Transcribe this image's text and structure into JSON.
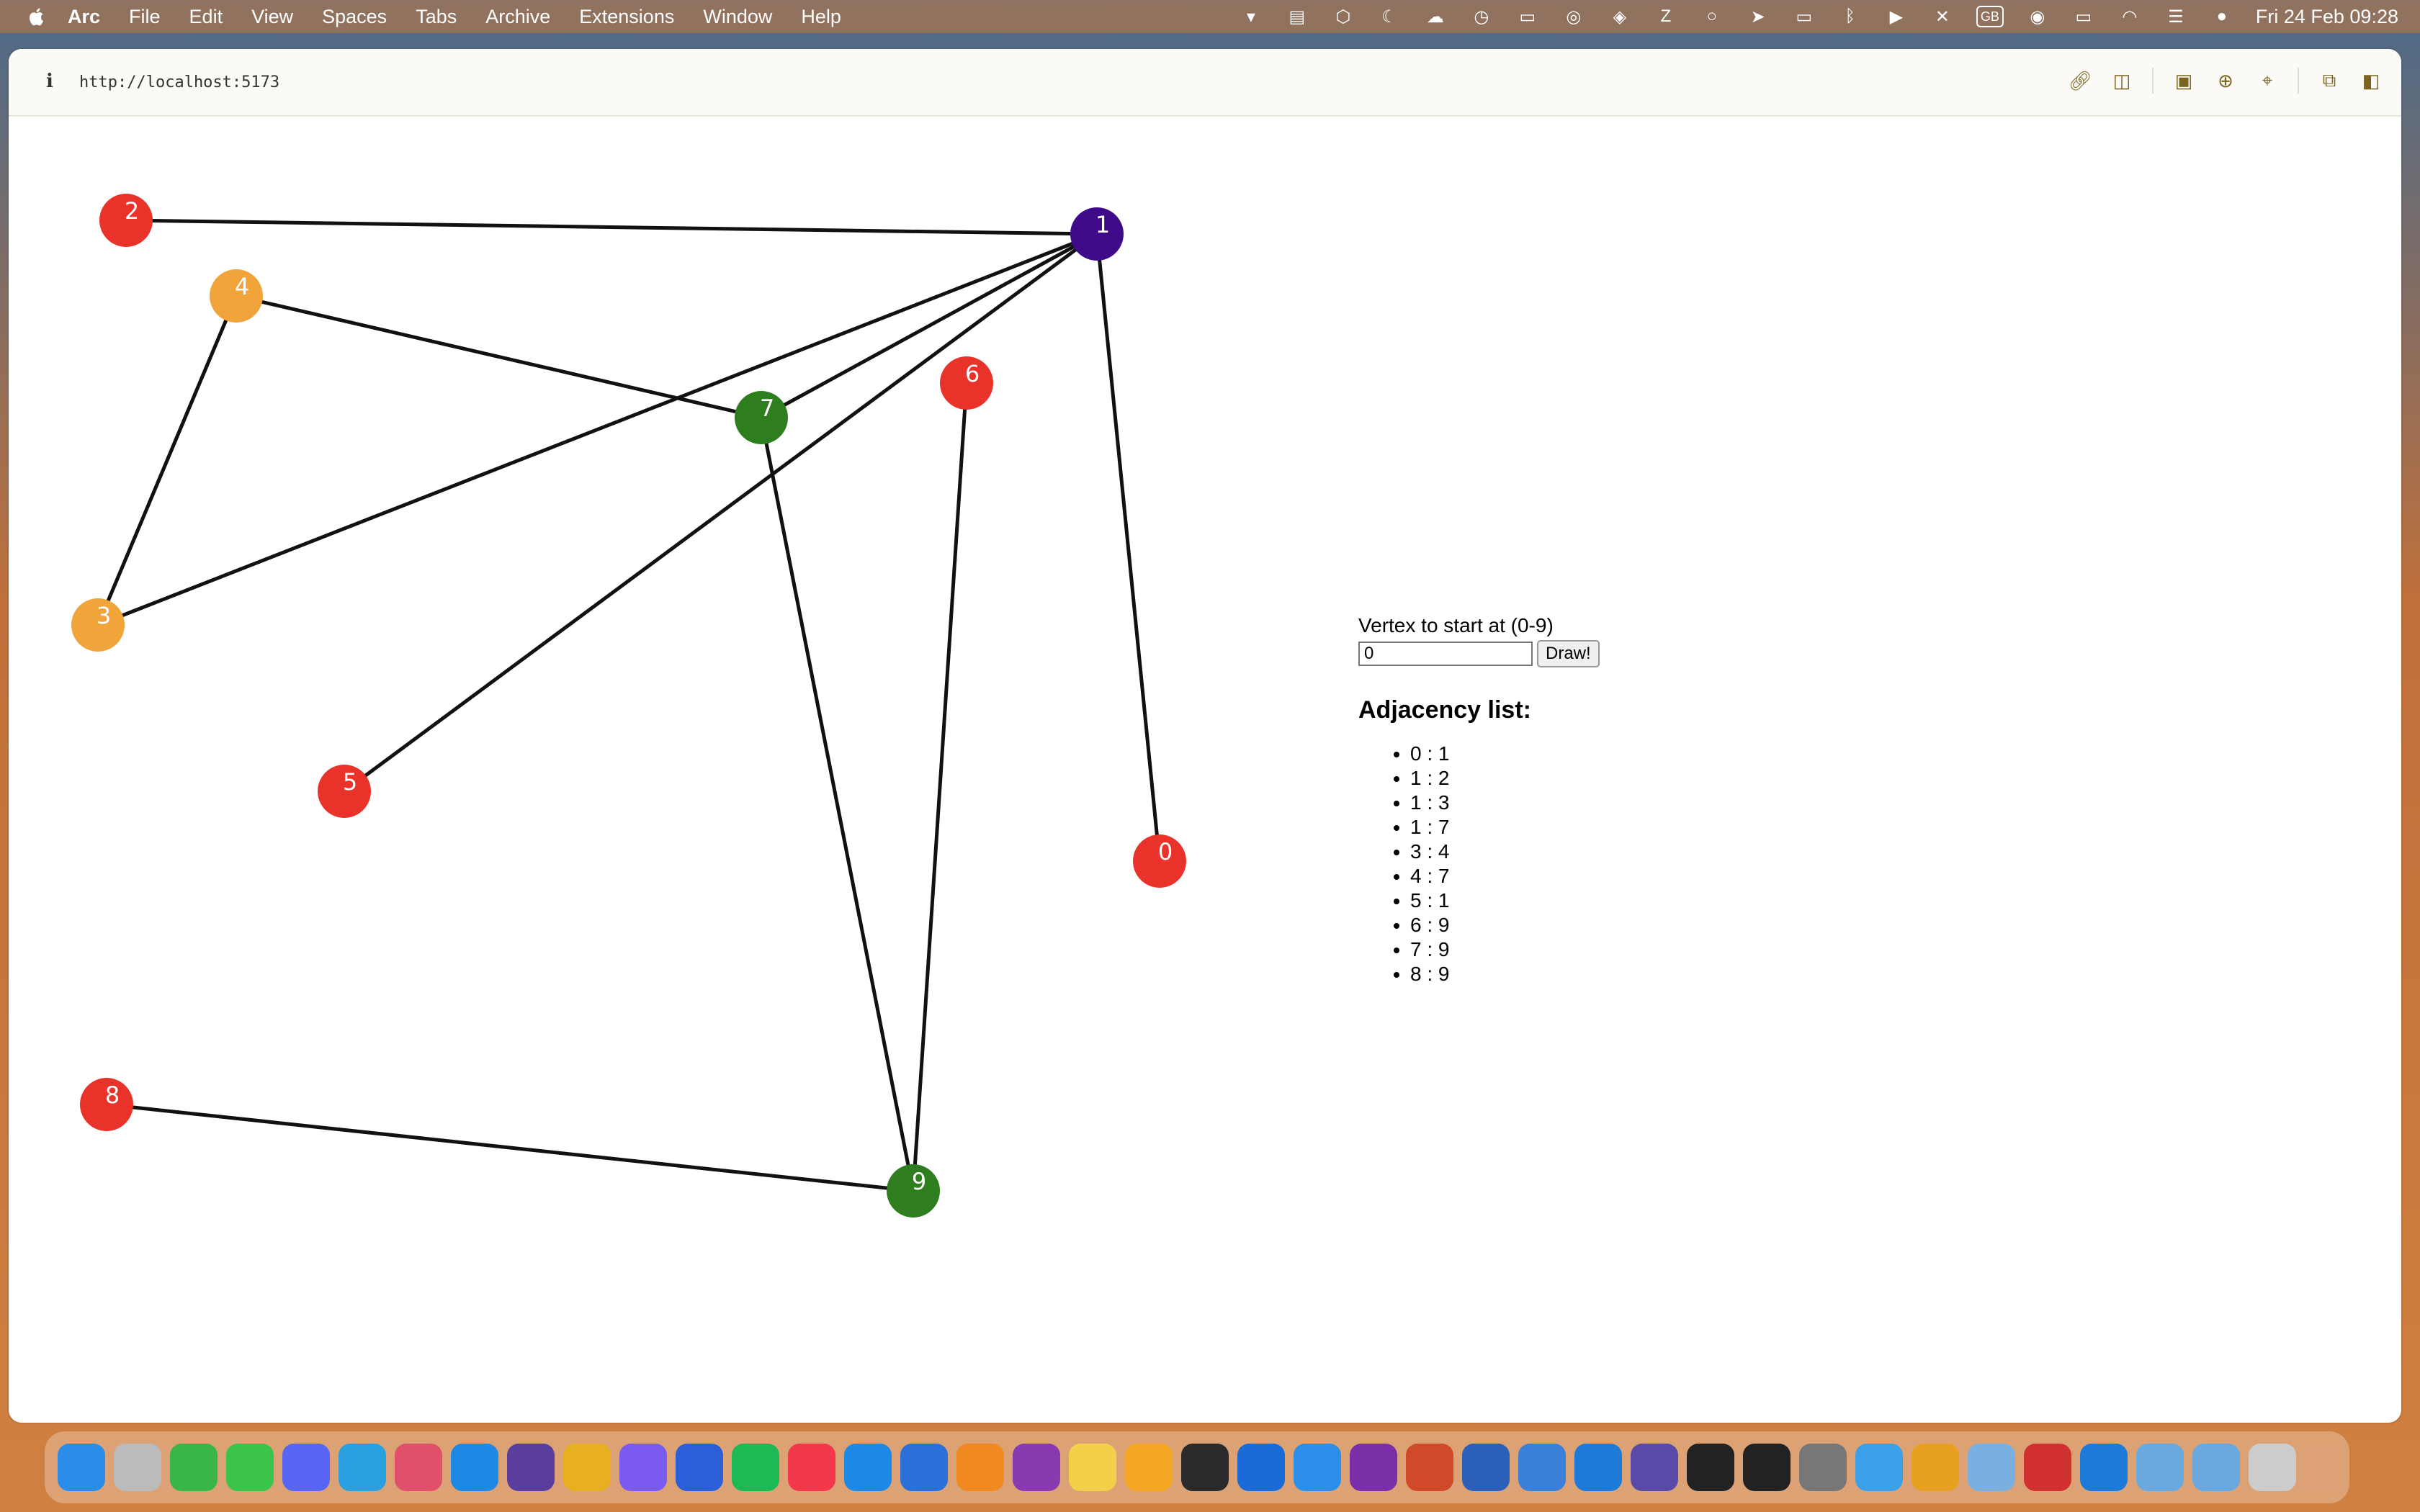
{
  "menubar": {
    "items": [
      "Arc",
      "File",
      "Edit",
      "View",
      "Spaces",
      "Tabs",
      "Archive",
      "Extensions",
      "Window",
      "Help"
    ],
    "keyboard_layout": "GB",
    "clock": "Fri 24 Feb  09:28"
  },
  "browser": {
    "url": "http://localhost:5173"
  },
  "graph": {
    "vertices": [
      {
        "id": "0",
        "color": "#e8322a"
      },
      {
        "id": "1",
        "color": "#3f0a8a"
      },
      {
        "id": "2",
        "color": "#e8322a"
      },
      {
        "id": "3",
        "color": "#f0a43a"
      },
      {
        "id": "4",
        "color": "#f0a43a"
      },
      {
        "id": "5",
        "color": "#e8322a"
      },
      {
        "id": "6",
        "color": "#e8322a"
      },
      {
        "id": "7",
        "color": "#2e7d1e"
      },
      {
        "id": "8",
        "color": "#e8322a"
      },
      {
        "id": "9",
        "color": "#2e7d1e"
      }
    ],
    "edges": [
      [
        "0",
        "1"
      ],
      [
        "1",
        "2"
      ],
      [
        "1",
        "3"
      ],
      [
        "1",
        "7"
      ],
      [
        "3",
        "4"
      ],
      [
        "4",
        "7"
      ],
      [
        "5",
        "1"
      ],
      [
        "6",
        "9"
      ],
      [
        "7",
        "9"
      ],
      [
        "8",
        "9"
      ]
    ]
  },
  "panel": {
    "vertex_label": "Vertex to start at (0-9)",
    "vertex_value": "0",
    "draw_label": "Draw!",
    "adjacency_title": "Adjacency list:",
    "adjacency": [
      "0 : 1",
      "1 : 2",
      "1 : 3",
      "1 : 7",
      "3 : 4",
      "4 : 7",
      "5 : 1",
      "6 : 9",
      "7 : 9",
      "8 : 9"
    ]
  },
  "dock": {
    "apps": [
      "finder-icon",
      "launchpad-icon",
      "facetime-icon",
      "messages-icon",
      "discord-icon",
      "telegram-icon",
      "affinity-icon",
      "safari-icon",
      "browser-icon",
      "chrome-icon",
      "safari-tech-icon",
      "firefox-icon",
      "spotify-icon",
      "music-icon",
      "app-store-icon",
      "xcode-tools-icon",
      "books-icon",
      "affinity-photo-icon",
      "notes-icon",
      "sketch-icon",
      "app-icon",
      "keynote-icon",
      "mail-icon",
      "onenote-icon",
      "powerpoint-icon",
      "word-icon",
      "xcode-icon",
      "vscode-icon",
      "sourcetree-icon",
      "activity-monitor-icon",
      "terminal-icon",
      "system-settings-icon",
      "arc-icon",
      "transmit-icon",
      "preview-icon",
      "photo-booth-icon",
      "vscode-icon-2",
      "folder-icon",
      "folder-icon-2",
      "trash-icon"
    ],
    "colors": [
      "#2a8ee8",
      "#bbb",
      "#3ab54a",
      "#3ac54a",
      "#5865f2",
      "#2aa0e0",
      "#e0506a",
      "#1e88e5",
      "#5a3e9e",
      "#e8b020",
      "#7a5af0",
      "#2b5fd8",
      "#1db954",
      "#f2384a",
      "#1e88e5",
      "#2b6fd8",
      "#f08a20",
      "#8a3ab0",
      "#f4d04a",
      "#f5a623",
      "#2a2a2a",
      "#1a6ad8",
      "#2b8ee8",
      "#7b2fa8",
      "#d04a2a",
      "#2b5fb8",
      "#3a80d8",
      "#1e7ad8",
      "#5a4aa8",
      "#222",
      "#222",
      "#777",
      "#3aa0e8",
      "#e8a020",
      "#7ab0e0",
      "#d03030",
      "#1e7ad8",
      "#6aa8e0",
      "#6aa8e0",
      "#ccc"
    ]
  }
}
